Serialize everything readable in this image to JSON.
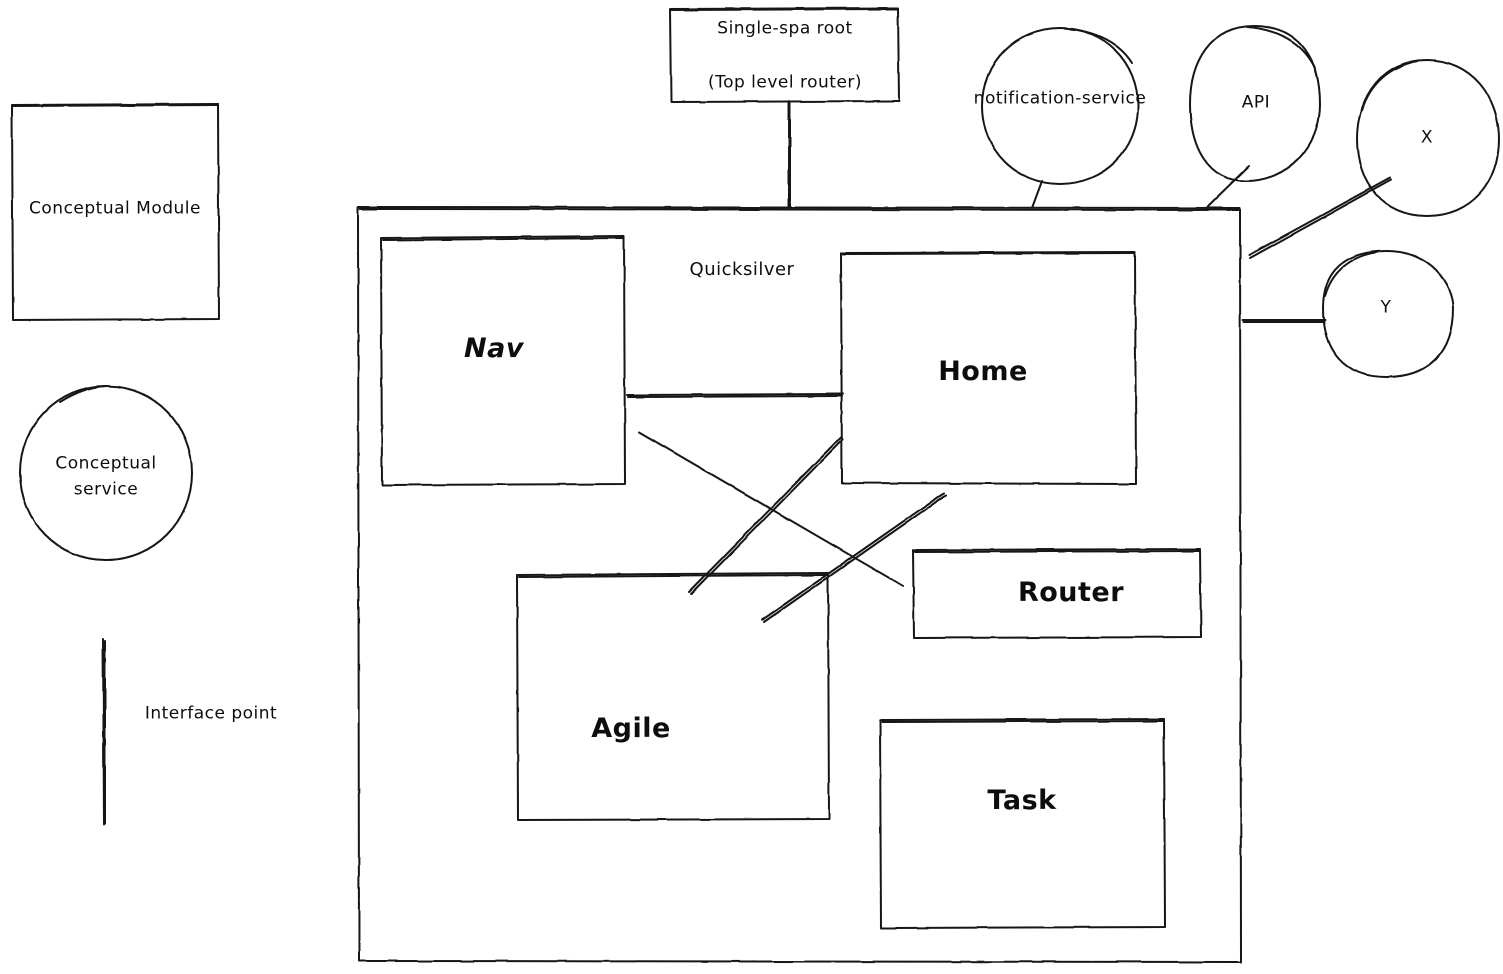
{
  "diagram": {
    "type": "hand-drawn-architecture",
    "background_color": "#ffffff",
    "stroke_color": "#141414",
    "text_color": "#0d0d0d"
  },
  "legend": {
    "module_shape_label": "Conceptual Module",
    "service_shape_label_line1": "Conceptual",
    "service_shape_label_line2": "service",
    "interface_point_label": "Interface point"
  },
  "root": {
    "line1": "Single-spa root",
    "line2": "(Top level router)"
  },
  "container": {
    "name": "Quicksilver"
  },
  "modules": [
    {
      "id": "nav",
      "label": "Nav"
    },
    {
      "id": "home",
      "label": "Home"
    },
    {
      "id": "router",
      "label": "Router"
    },
    {
      "id": "agile",
      "label": "Agile"
    },
    {
      "id": "task",
      "label": "Task"
    }
  ],
  "services": [
    {
      "id": "notification-service",
      "label": "notification-service"
    },
    {
      "id": "api",
      "label": "API"
    },
    {
      "id": "x",
      "label": "X"
    },
    {
      "id": "y",
      "label": "Y"
    }
  ],
  "connections": [
    {
      "from": "Single-spa root",
      "to": "Quicksilver"
    },
    {
      "from": "notification-service",
      "to": "Quicksilver"
    },
    {
      "from": "API",
      "to": "Quicksilver"
    },
    {
      "from": "X",
      "to": "Quicksilver"
    },
    {
      "from": "Y",
      "to": "Quicksilver"
    },
    {
      "from": "Nav",
      "to": "Home"
    },
    {
      "from": "Nav",
      "to": "Router"
    },
    {
      "from": "Home",
      "to": "Agile"
    },
    {
      "from": "Agile",
      "to": "Home"
    }
  ]
}
